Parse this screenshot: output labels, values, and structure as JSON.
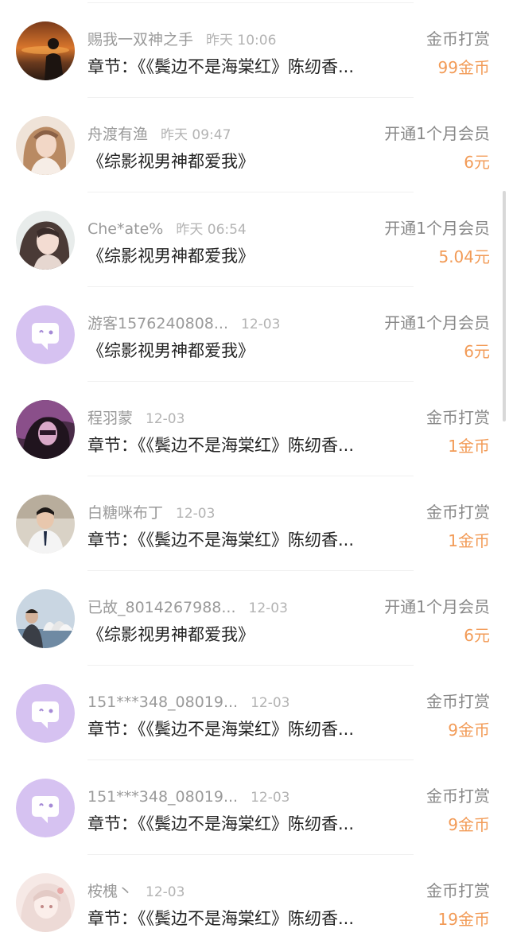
{
  "rows": [
    {
      "name": "赐我一双神之手",
      "time": "昨天 10:06",
      "content": "章节：《《鬓边不是海棠红》陈纫香...",
      "type": "金币打赏",
      "amount": "99金币",
      "avatar": "sunset-photo"
    },
    {
      "name": "舟渡有渔",
      "time": "昨天 09:47",
      "content": "《综影视男神都爱我》",
      "type": "开通1个月会员",
      "amount": "6元",
      "avatar": "girl-photo"
    },
    {
      "name": "Che*ate%",
      "time": "昨天 06:54",
      "content": "《综影视男神都爱我》",
      "type": "开通1个月会员",
      "amount": "5.04元",
      "avatar": "girl-photo-2"
    },
    {
      "name": "游客1576240808...",
      "time": "12-03",
      "content": "《综影视男神都爱我》",
      "type": "开通1个月会员",
      "amount": "6元",
      "avatar": "default-chat-avatar"
    },
    {
      "name": "程羽蒙",
      "time": "12-03",
      "content": "章节：《《鬓边不是海棠红》陈纫香...",
      "type": "金币打赏",
      "amount": "1金币",
      "avatar": "purple-photo"
    },
    {
      "name": "白糖咪布丁",
      "time": "12-03",
      "content": "章节：《《鬓边不是海棠红》陈纫香...",
      "type": "金币打赏",
      "amount": "1金币",
      "avatar": "boy-photo"
    },
    {
      "name": "已故_8014267988...",
      "time": "12-03",
      "content": "《综影视男神都爱我》",
      "type": "开通1个月会员",
      "amount": "6元",
      "avatar": "opera-house-photo"
    },
    {
      "name": "151***348_08019...",
      "time": "12-03",
      "content": "章节：《《鬓边不是海棠红》陈纫香...",
      "type": "金币打赏",
      "amount": "9金币",
      "avatar": "default-chat-avatar"
    },
    {
      "name": "151***348_08019...",
      "time": "12-03",
      "content": "章节：《《鬓边不是海棠红》陈纫香...",
      "type": "金币打赏",
      "amount": "9金币",
      "avatar": "default-chat-avatar"
    },
    {
      "name": "桉槐丶",
      "time": "12-03",
      "content": "章节：《《鬓边不是海棠红》陈纫香...",
      "type": "金币打赏",
      "amount": "19金币",
      "avatar": "anime-photo"
    }
  ],
  "colors": {
    "amount": "#f29b57",
    "default_avatar": "#d6c2f1"
  }
}
